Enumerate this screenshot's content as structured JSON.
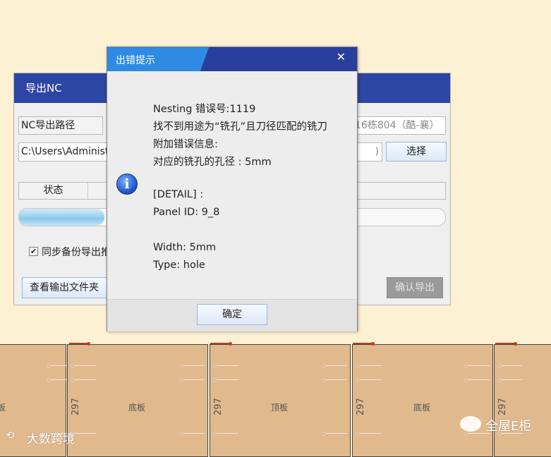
{
  "export_dialog": {
    "title": "导出NC",
    "path_label": "NC导出路径",
    "path_value": "C:\\Users\\Administrator",
    "file_name_tail": "16栋804（酷-襄）",
    "small_field_tail": ")",
    "select_button": "选择",
    "status_header": "状态",
    "progress": 0.2,
    "sync_backup_label": "同步备份导出推",
    "sync_backup_checked": true,
    "open_folder_button": "查看输出文件夹",
    "confirm_export_button": "确认导出"
  },
  "error_dialog": {
    "title": "出错提示",
    "close_icon": "close-icon",
    "icon": "info-icon",
    "message_lines": [
      "Nesting 错误号:1119",
      "找不到用途为“铣孔”且刀径匹配的铣刀",
      "附加错误信息:",
      "对应的铣孔的孔径 : 5mm",
      "",
      "[DETAIL] :",
      "Panel ID:  9_8",
      "",
      "Width:  5mm",
      "Type:  hole"
    ],
    "ok_button": "确定"
  },
  "panels": [
    {
      "name": "板",
      "dim": ""
    },
    {
      "name": "底板",
      "dim": "297"
    },
    {
      "name": "顶板",
      "dim": "297"
    },
    {
      "name": "底板",
      "dim": "297"
    },
    {
      "name": "",
      "dim": "297"
    }
  ],
  "watermarks": {
    "left": "大数跨境",
    "right": "全屋E柜"
  },
  "colors": {
    "title_blue": "#2e46a3",
    "title_light_blue": "#2f8ae3",
    "panel_fill": "#e0b98d",
    "background": "#fdf1d3"
  }
}
